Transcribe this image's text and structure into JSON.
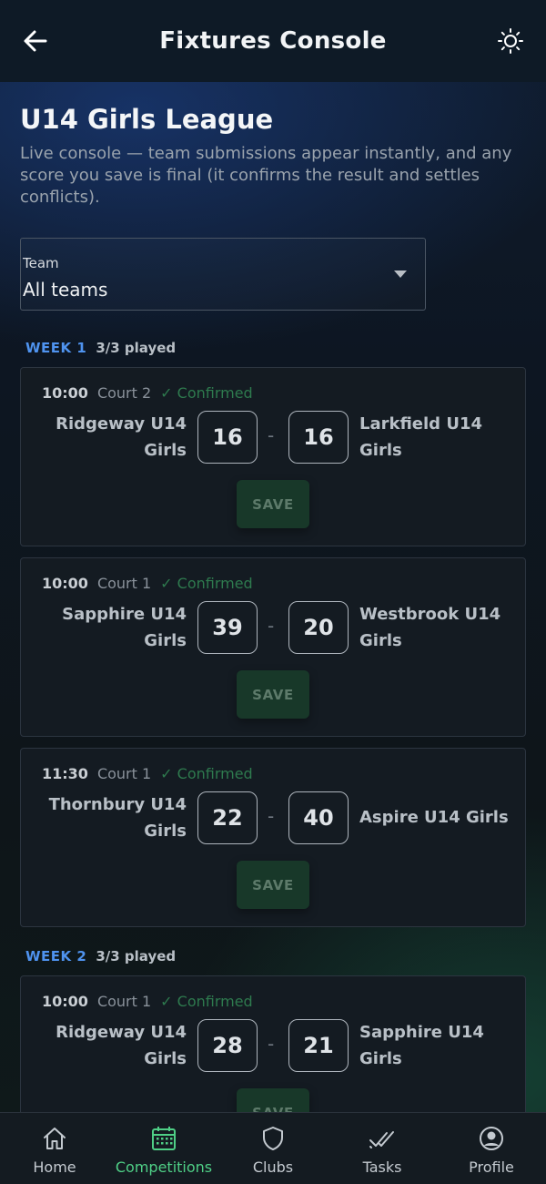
{
  "header": {
    "title": "Fixtures Console"
  },
  "league": {
    "title": "U14 Girls League",
    "description": "Live console — team submissions appear instantly, and any score you save is final (it confirms the result and settles conflicts)."
  },
  "team_filter": {
    "label": "Team",
    "value": "All teams"
  },
  "weeks": [
    {
      "label": "WEEK 1",
      "played": "3/3 played",
      "fixtures": [
        {
          "time": "10:00",
          "court": "Court 2",
          "status": "✓ Confirmed",
          "home": "Ridgeway U14 Girls",
          "home_score": "16",
          "away_score": "16",
          "away": "Larkfield U14 Girls",
          "save_label": "SAVE"
        },
        {
          "time": "10:00",
          "court": "Court 1",
          "status": "✓ Confirmed",
          "home": "Sapphire U14 Girls",
          "home_score": "39",
          "away_score": "20",
          "away": "Westbrook U14 Girls",
          "save_label": "SAVE"
        },
        {
          "time": "11:30",
          "court": "Court 1",
          "status": "✓ Confirmed",
          "home": "Thornbury U14 Girls",
          "home_score": "22",
          "away_score": "40",
          "away": "Aspire U14 Girls",
          "save_label": "SAVE"
        }
      ]
    },
    {
      "label": "WEEK 2",
      "played": "3/3 played",
      "fixtures": [
        {
          "time": "10:00",
          "court": "Court 1",
          "status": "✓ Confirmed",
          "home": "Ridgeway U14 Girls",
          "home_score": "28",
          "away_score": "21",
          "away": "Sapphire U14 Girls",
          "save_label": "SAVE"
        }
      ]
    }
  ],
  "score_separator": "-",
  "nav": {
    "items": [
      {
        "label": "Home",
        "icon": "home-icon"
      },
      {
        "label": "Competitions",
        "icon": "calendar-icon",
        "active": true
      },
      {
        "label": "Clubs",
        "icon": "shield-icon"
      },
      {
        "label": "Tasks",
        "icon": "double-check-icon"
      },
      {
        "label": "Profile",
        "icon": "account-circle-icon"
      }
    ]
  },
  "colors": {
    "accent_blue": "#4f93ef",
    "accent_green": "#4fcf86",
    "confirmed": "#2e7a4e"
  }
}
